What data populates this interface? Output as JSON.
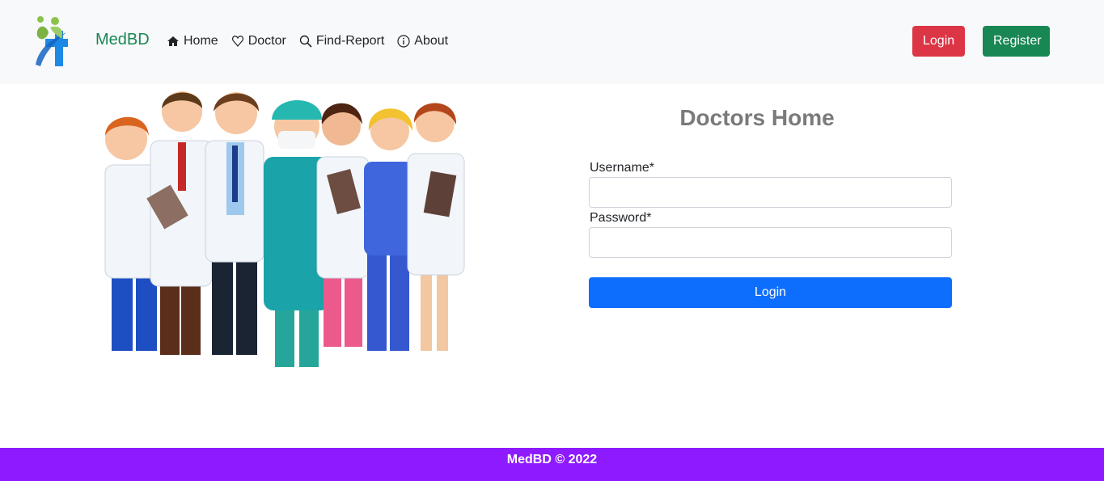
{
  "navbar": {
    "brand": "MedBD",
    "links": [
      {
        "label": "Home",
        "icon": "house-icon"
      },
      {
        "label": "Doctor",
        "icon": "heart-outline-icon"
      },
      {
        "label": "Find-Report",
        "icon": "search-icon"
      },
      {
        "label": "About",
        "icon": "info-icon"
      }
    ],
    "login_label": "Login",
    "register_label": "Register"
  },
  "form": {
    "title": "Doctors Home",
    "username_label": "Username*",
    "password_label": "Password*",
    "username_value": "",
    "password_value": "",
    "submit_label": "Login"
  },
  "footer": {
    "text": "MedBD © 2022"
  },
  "colors": {
    "navbar_bg": "#f8f9fa",
    "brand": "#198754",
    "login_button": "#dc3545",
    "register_button": "#198754",
    "submit_button": "#0d6efd",
    "footer_bg": "#8e1bff"
  }
}
